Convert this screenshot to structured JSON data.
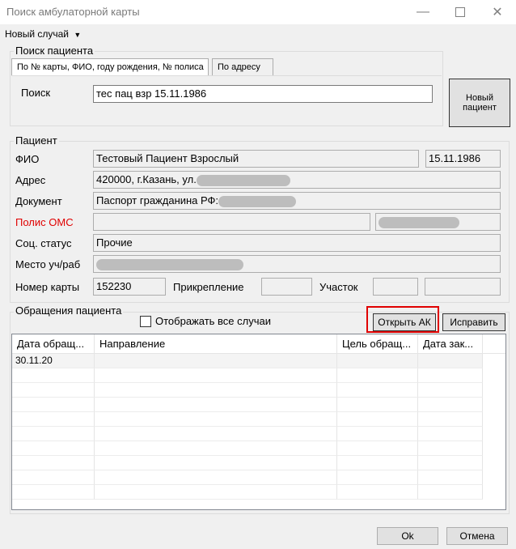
{
  "window": {
    "title": "Поиск амбулаторной карты",
    "minimize_icon": "minimize-icon",
    "maximize_icon": "maximize-icon",
    "close_icon": "close-icon"
  },
  "menu": {
    "new_case_label": "Новый случай"
  },
  "search": {
    "group_title": "Поиск пациента",
    "tabs": [
      {
        "label": "По № карты, ФИО, году рождения, № полиса"
      },
      {
        "label": "По адресу"
      }
    ],
    "label": "Поиск",
    "value": "тес пац взр 15.11.1986",
    "new_patient_label": "Новый пациент"
  },
  "patient": {
    "group_title": "Пациент",
    "fio_label": "ФИО",
    "fio_value": "Тестовый Пациент Взрослый",
    "birthdate": "15.11.1986",
    "address_label": "Адрес",
    "address_value": "420000, г.Казань, ул.",
    "document_label": "Документ",
    "document_value": "Паспорт гражданина РФ:",
    "policy_label": "Полис ОМС",
    "policy_label_color": "#e00000",
    "social_label": "Соц. статус",
    "social_value": "Прочие",
    "workplace_label": "Место уч/раб",
    "card_label": "Номер карты",
    "card_value": "152230",
    "attachment_label": "Прикрепление",
    "district_label": "Участок"
  },
  "visits": {
    "group_title": "Обращения пациента",
    "show_all_label": "Отображать все случаи",
    "show_all_checked": false,
    "open_ak_label": "Открыть АК",
    "fix_label": "Исправить",
    "highlight_color": "#e00000",
    "columns": [
      "Дата обращ...",
      "Направление",
      "Цель обращ...",
      "Дата зак..."
    ],
    "rows": [
      [
        "30.11.20",
        "",
        "",
        ""
      ]
    ]
  },
  "footer": {
    "ok_label": "Ok",
    "cancel_label": "Отмена"
  }
}
